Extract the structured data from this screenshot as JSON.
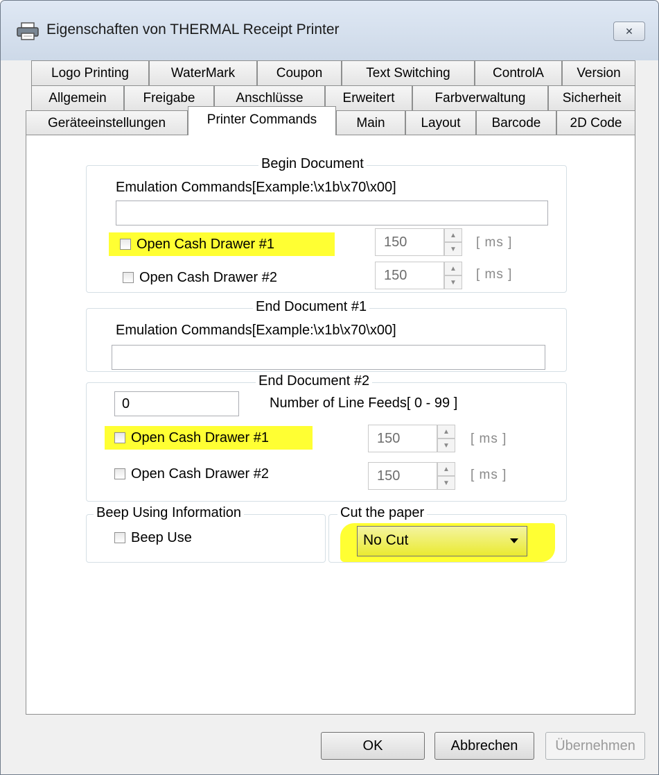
{
  "window": {
    "title": "Eigenschaften von THERMAL Receipt Printer",
    "close_glyph": "✕"
  },
  "tabs": {
    "row1": [
      "Logo Printing",
      "WaterMark",
      "Coupon",
      "Text Switching",
      "ControlA",
      "Version"
    ],
    "row2": [
      "Allgemein",
      "Freigabe",
      "Anschlüsse",
      "Erweitert",
      "Farbverwaltung",
      "Sicherheit"
    ],
    "row3": [
      "Geräteeinstellungen",
      "Printer Commands",
      "Main",
      "Layout",
      "Barcode",
      "2D Code"
    ],
    "active": "Printer Commands"
  },
  "begin_document": {
    "legend": "Begin Document",
    "emulation_label": "Emulation Commands[Example:\\x1b\\x70\\x00]",
    "emulation_value": "",
    "drawer1_label": "Open Cash Drawer #1",
    "drawer1_ms": "150",
    "drawer2_label": "Open Cash Drawer #2",
    "drawer2_ms": "150",
    "unit": "[ ms ]"
  },
  "end_document_1": {
    "legend": "End Document #1",
    "emulation_label": "Emulation Commands[Example:\\x1b\\x70\\x00]",
    "emulation_value": ""
  },
  "end_document_2": {
    "legend": "End Document #2",
    "line_feeds_value": "0",
    "line_feeds_label": "Number of Line Feeds[ 0 - 99 ]",
    "drawer1_label": "Open Cash Drawer #1",
    "drawer1_ms": "150",
    "drawer2_label": "Open Cash Drawer #2",
    "drawer2_ms": "150",
    "unit": "[ ms ]"
  },
  "beep": {
    "legend": "Beep Using Information",
    "checkbox_label": "Beep Use"
  },
  "cut": {
    "legend": "Cut the paper",
    "selected": "No Cut"
  },
  "buttons": {
    "ok": "OK",
    "cancel": "Abbrechen",
    "apply": "Übernehmen"
  },
  "colors": {
    "highlight": "#ffff33",
    "window_bg": "#f0f0f0",
    "panel_bg": "#ffffff"
  },
  "icons": {
    "title": "printer-icon",
    "close": "close-icon",
    "dropdown": "chevron-down-icon",
    "spin_up": "spin-up-icon",
    "spin_down": "spin-down-icon"
  }
}
